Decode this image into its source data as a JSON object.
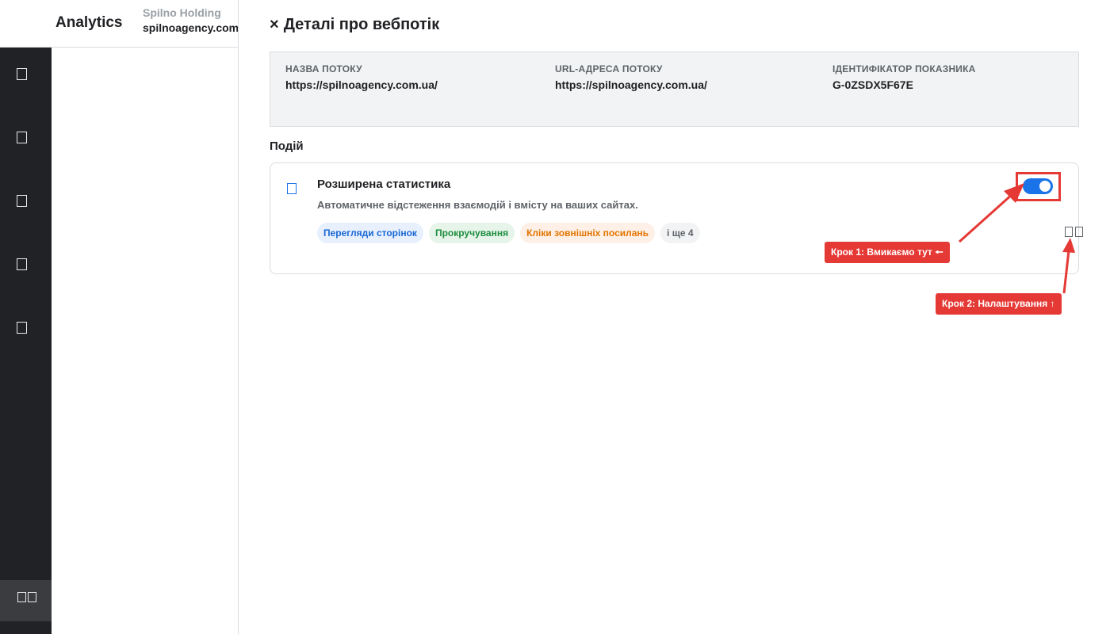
{
  "app": {
    "title": "Analytics",
    "org": "Spilno Holding",
    "property": "spilnoagency.com"
  },
  "rail": {
    "icons": [
      "rail-home-icon",
      "rail-reports-icon",
      "rail-explore-icon",
      "rail-advertising-icon",
      "rail-configure-icon"
    ],
    "bottom_icon": "rail-admin-icon"
  },
  "dialog": {
    "close_glyph": "×",
    "title": "Деталі про вебпотік",
    "stream": {
      "name_label": "НАЗВА ПОТОКУ",
      "name_value": "https://spilnoagency.com.ua/",
      "url_label": "URL-АДРЕСА ПОТОКУ",
      "url_value": "https://spilnoagency.com.ua/",
      "id_label": "ІДЕНТИФІКАТОР ПОКАЗНИКА",
      "id_value": "G-0ZSDX5F67E"
    },
    "events_heading": "Подій",
    "enhanced": {
      "title": "Розширена статистика",
      "description": "Автоматичне відстеження взаємодій і вмісту на ваших сайтах.",
      "chips": [
        {
          "label": "Перегляди сторінок",
          "color": "#1967d2"
        },
        {
          "label": "Прокручування",
          "color": "#1e8e3e"
        },
        {
          "label": "Кліки зовнішніх посилань",
          "color": "#e37400"
        },
        {
          "label": "і ще 4",
          "color": "#5f6368"
        }
      ],
      "toggle_on": true,
      "settings_icon": "gear-icon"
    }
  },
  "annotations": {
    "step1": "Крок 1: Вмикаємо тут 🠔",
    "step2": "Крок 2: Налаштування ↑",
    "color": "#e53935"
  },
  "colors": {
    "accent": "#1a73e8",
    "rail": "#212226",
    "panel": "#f1f3f4"
  }
}
